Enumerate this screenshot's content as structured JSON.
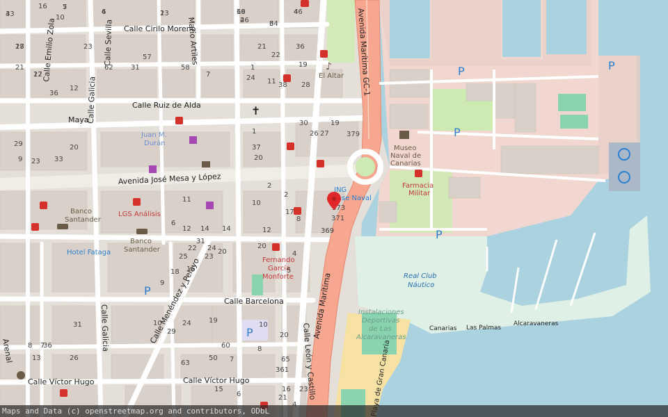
{
  "map": {
    "colors": {
      "sea": "#aad3df",
      "land": "#e4dfd8",
      "block": "#d9d0c9",
      "road": "#ffffff",
      "primary": "#f7a68f",
      "park": "#cdebb0",
      "military": "#f1d7cf",
      "beach": "#f7e2a4",
      "marina": "#dff0e6"
    },
    "streets": [
      {
        "id": "st-cirilo",
        "text": "Calle Cirilo Moreno"
      },
      {
        "id": "st-zola",
        "text": "Calle Emilio Zola"
      },
      {
        "id": "st-sevilla",
        "text": "Calle Sevilla"
      },
      {
        "id": "st-galicia-n",
        "text": "Calle Galicia"
      },
      {
        "id": "st-ruiz",
        "text": "Calle Ruiz de Alda"
      },
      {
        "id": "st-maya",
        "text": "Maya"
      },
      {
        "id": "st-mesa",
        "text": "Avenida José Mesa y López"
      },
      {
        "id": "st-maritima-gc1",
        "text": "Avenida Marítima GC-1"
      },
      {
        "id": "st-maritima",
        "text": "Avenida Marítima"
      },
      {
        "id": "st-barcelona",
        "text": "Calle Barcelona"
      },
      {
        "id": "st-menendez",
        "text": "Calle Menéndez y Pelayo"
      },
      {
        "id": "st-galicia-s",
        "text": "Calle Galicia"
      },
      {
        "id": "st-leon",
        "text": "Calle León y Castillo"
      },
      {
        "id": "st-hugo-w",
        "text": "Calle Víctor Hugo"
      },
      {
        "id": "st-hugo-e",
        "text": "Calle Víctor Hugo"
      },
      {
        "id": "st-artiles",
        "text": "Mario Artiles"
      },
      {
        "id": "st-arenal",
        "text": "Arenal"
      },
      {
        "id": "st-canarias-pier",
        "text": "Canarias"
      },
      {
        "id": "st-las-palmas",
        "text": "Las Palmas"
      },
      {
        "id": "st-alcaravaneras",
        "text": "Alcaravaneras"
      },
      {
        "id": "st-playa",
        "text": "Playa de Gran Canaria"
      }
    ],
    "places": [
      {
        "id": "pl-juan",
        "lines": [
          "Juan M.",
          "Durán"
        ]
      },
      {
        "id": "pl-banco1",
        "lines": [
          "Banco",
          "Santander"
        ]
      },
      {
        "id": "pl-lgs",
        "lines": [
          "LGS Análisis"
        ]
      },
      {
        "id": "pl-banco2",
        "lines": [
          "Banco",
          "Santander"
        ]
      },
      {
        "id": "pl-hotel",
        "lines": [
          "Hotel Fataga"
        ]
      },
      {
        "id": "pl-museo",
        "lines": [
          "Museo",
          "Naval de",
          "Canarias"
        ]
      },
      {
        "id": "pl-farmacia",
        "lines": [
          "Farmacia",
          "Militar"
        ]
      },
      {
        "id": "pl-ing",
        "lines": [
          "ING",
          "Base Naval"
        ]
      },
      {
        "id": "pl-fernando",
        "lines": [
          "Fernando",
          "García",
          "Monforte"
        ]
      },
      {
        "id": "pl-real",
        "lines": [
          "Real Club",
          "Náutico"
        ]
      },
      {
        "id": "pl-inst",
        "lines": [
          "Instalaciones",
          "Deportivas",
          "de Las",
          "Alcaravaneras"
        ]
      },
      {
        "id": "pl-altar",
        "lines": [
          "El Altar"
        ]
      }
    ],
    "numbers": [
      "7",
      "6",
      "43",
      "13",
      "3",
      "4",
      "19",
      "2",
      "18",
      "17",
      "36",
      "57",
      "31",
      "12",
      "62",
      "58",
      "21",
      "7",
      "36",
      "22",
      "1",
      "11",
      "19",
      "24",
      "28",
      "38",
      "23",
      "29",
      "20",
      "1",
      "20",
      "26",
      "30",
      "27",
      "19",
      "37",
      "379",
      "373",
      "371",
      "369",
      "8",
      "10",
      "6",
      "12",
      "14",
      "2",
      "11",
      "2",
      "17",
      "12",
      "14",
      "31",
      "24",
      "23",
      "22",
      "20",
      "25",
      "16",
      "18",
      "20",
      "4",
      "5",
      "7",
      "9",
      "19",
      "10",
      "29",
      "8",
      "7",
      "13",
      "36",
      "31",
      "26",
      "24",
      "10",
      "20",
      "8",
      "65",
      "63",
      "60",
      "50",
      "7",
      "15",
      "6",
      "361",
      "16",
      "21",
      "4",
      "23",
      "21",
      "16",
      "33",
      "9",
      "10",
      "23",
      "5",
      "4",
      "3",
      "2",
      "64",
      "46",
      "66",
      "46",
      "27",
      "22"
    ],
    "pins": {
      "main_marker": "map-marker"
    }
  },
  "attribution": "Maps and Data (c) openstreetmap.org and contributors, ODbL"
}
